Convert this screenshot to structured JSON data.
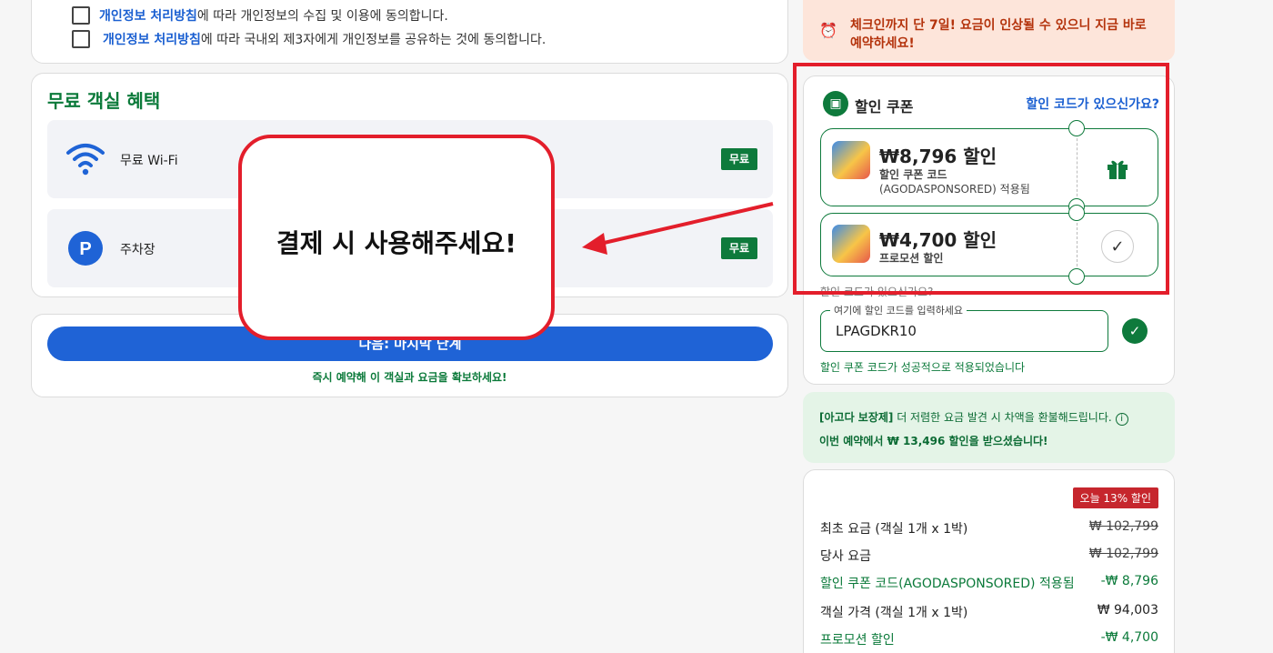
{
  "consent": {
    "row1_link": "개인정보 처리방침",
    "row1_text": "에 따라 개인정보의 수집 및 이용에 동의합니다.",
    "row2_link": "개인정보 처리방침",
    "row2_text": "에 따라 국내외 제3자에게 개인정보를 공유하는 것에 동의합니다."
  },
  "benefits": {
    "title": "무료 객실 혜택",
    "items": [
      {
        "label": "무료 Wi-Fi",
        "badge": "무료",
        "icon": "wifi-icon"
      },
      {
        "label": "주차장",
        "badge": "무료",
        "icon": "parking-icon"
      }
    ]
  },
  "next": {
    "button_label": "다음: 마지막 단계",
    "note": "즉시 예약해 이 객실과 요금을 확보하세요!"
  },
  "callout": {
    "text": "결제 시 사용해주세요!"
  },
  "urgency": {
    "text": "체크인까지 단 7일! 요금이 인상될 수 있으니 지금 바로 예약하세요!"
  },
  "coupon": {
    "title": "할인 쿠폰",
    "link": "할인 코드가 있으신가요?",
    "tickets": [
      {
        "amount": "₩8,796 할인",
        "line1": "할인 쿠폰 코드",
        "line2": "(AGODASPONSORED) 적용됨"
      },
      {
        "amount": "₩4,700 할인",
        "line1": "프로모션 할인",
        "line2": ""
      }
    ],
    "code_question": "할인 코드가 있으신가요?",
    "input_legend": "여기에 할인 코드를 입력하세요",
    "input_value": "LPAGDKR10",
    "success": "할인 쿠폰 코드가 성공적으로 적용되었습니다"
  },
  "guarantee": {
    "bold": "[아고다 보장제]",
    "text": " 더 저렴한 요금 발견 시 차액을 환불해드립니다.",
    "info_icon": "info-icon",
    "line2": "이번 예약에서 ₩ 13,496 할인을 받으셨습니다!"
  },
  "price": {
    "sale_badge": "오늘 13% 할인",
    "rows": [
      {
        "label": "최초 요금 (객실 1개 x 1박)",
        "value": "₩ 102,799"
      },
      {
        "label": "당사 요금",
        "value": "₩ 102,799"
      },
      {
        "label": "할인 쿠폰 코드(AGODASPONSORED) 적용됨",
        "value": "-₩ 8,796"
      },
      {
        "label": "객실 가격 (객실 1개 x 1박)",
        "value": "₩ 94,003"
      },
      {
        "label": "프로모션 할인",
        "value": "-₩ 4,700"
      }
    ]
  },
  "colors": {
    "accent_green": "#0e7a3c",
    "primary_blue": "#1f63d6",
    "highlight_red": "#e31e2b"
  }
}
